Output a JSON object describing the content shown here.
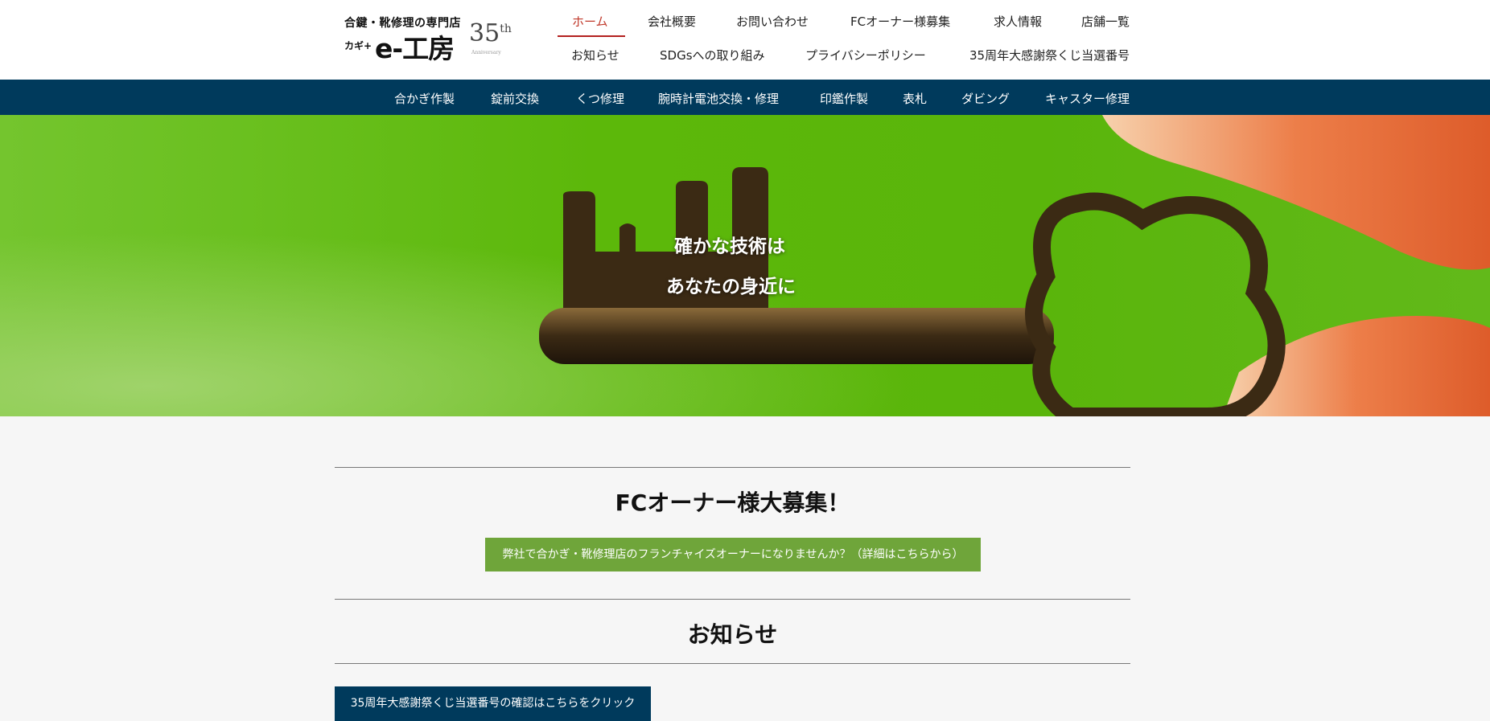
{
  "logo": {
    "tagline": "合鍵・靴修理の専門店",
    "prefix": "カギ+",
    "brand": "e-工房",
    "anniversary": "35",
    "anniversary_suffix": "th",
    "anniversary_sub": "Anniversary"
  },
  "top_nav": {
    "row1": [
      "ホーム",
      "会社概要",
      "お問い合わせ",
      "FCオーナー様募集",
      "求人情報",
      "店舗一覧"
    ],
    "row2": [
      "お知らせ",
      "SDGsへの取り組み",
      "プライバシーポリシー",
      "35周年大感謝祭くじ当選番号"
    ],
    "active": "ホーム"
  },
  "sub_nav": [
    "合かぎ作製",
    "錠前交換",
    "くつ修理",
    "腕時計電池交換・修理",
    "印鑑作製",
    "表札",
    "ダビング",
    "キャスター修理"
  ],
  "hero": {
    "line1": "確かな技術は",
    "line2": "あなたの身近に"
  },
  "fc_section": {
    "title": "FCオーナー様大募集！",
    "button": "弊社で合かぎ・靴修理店のフランチャイズオーナーになりませんか？（詳細はこちらから）"
  },
  "news_section": {
    "title": "お知らせ",
    "button": "35周年大感謝祭くじ当選番号の確認はこちらをクリック"
  },
  "colors": {
    "accent_red": "#b3201f",
    "navy": "#003a5c",
    "green_button": "#6fa53a"
  }
}
